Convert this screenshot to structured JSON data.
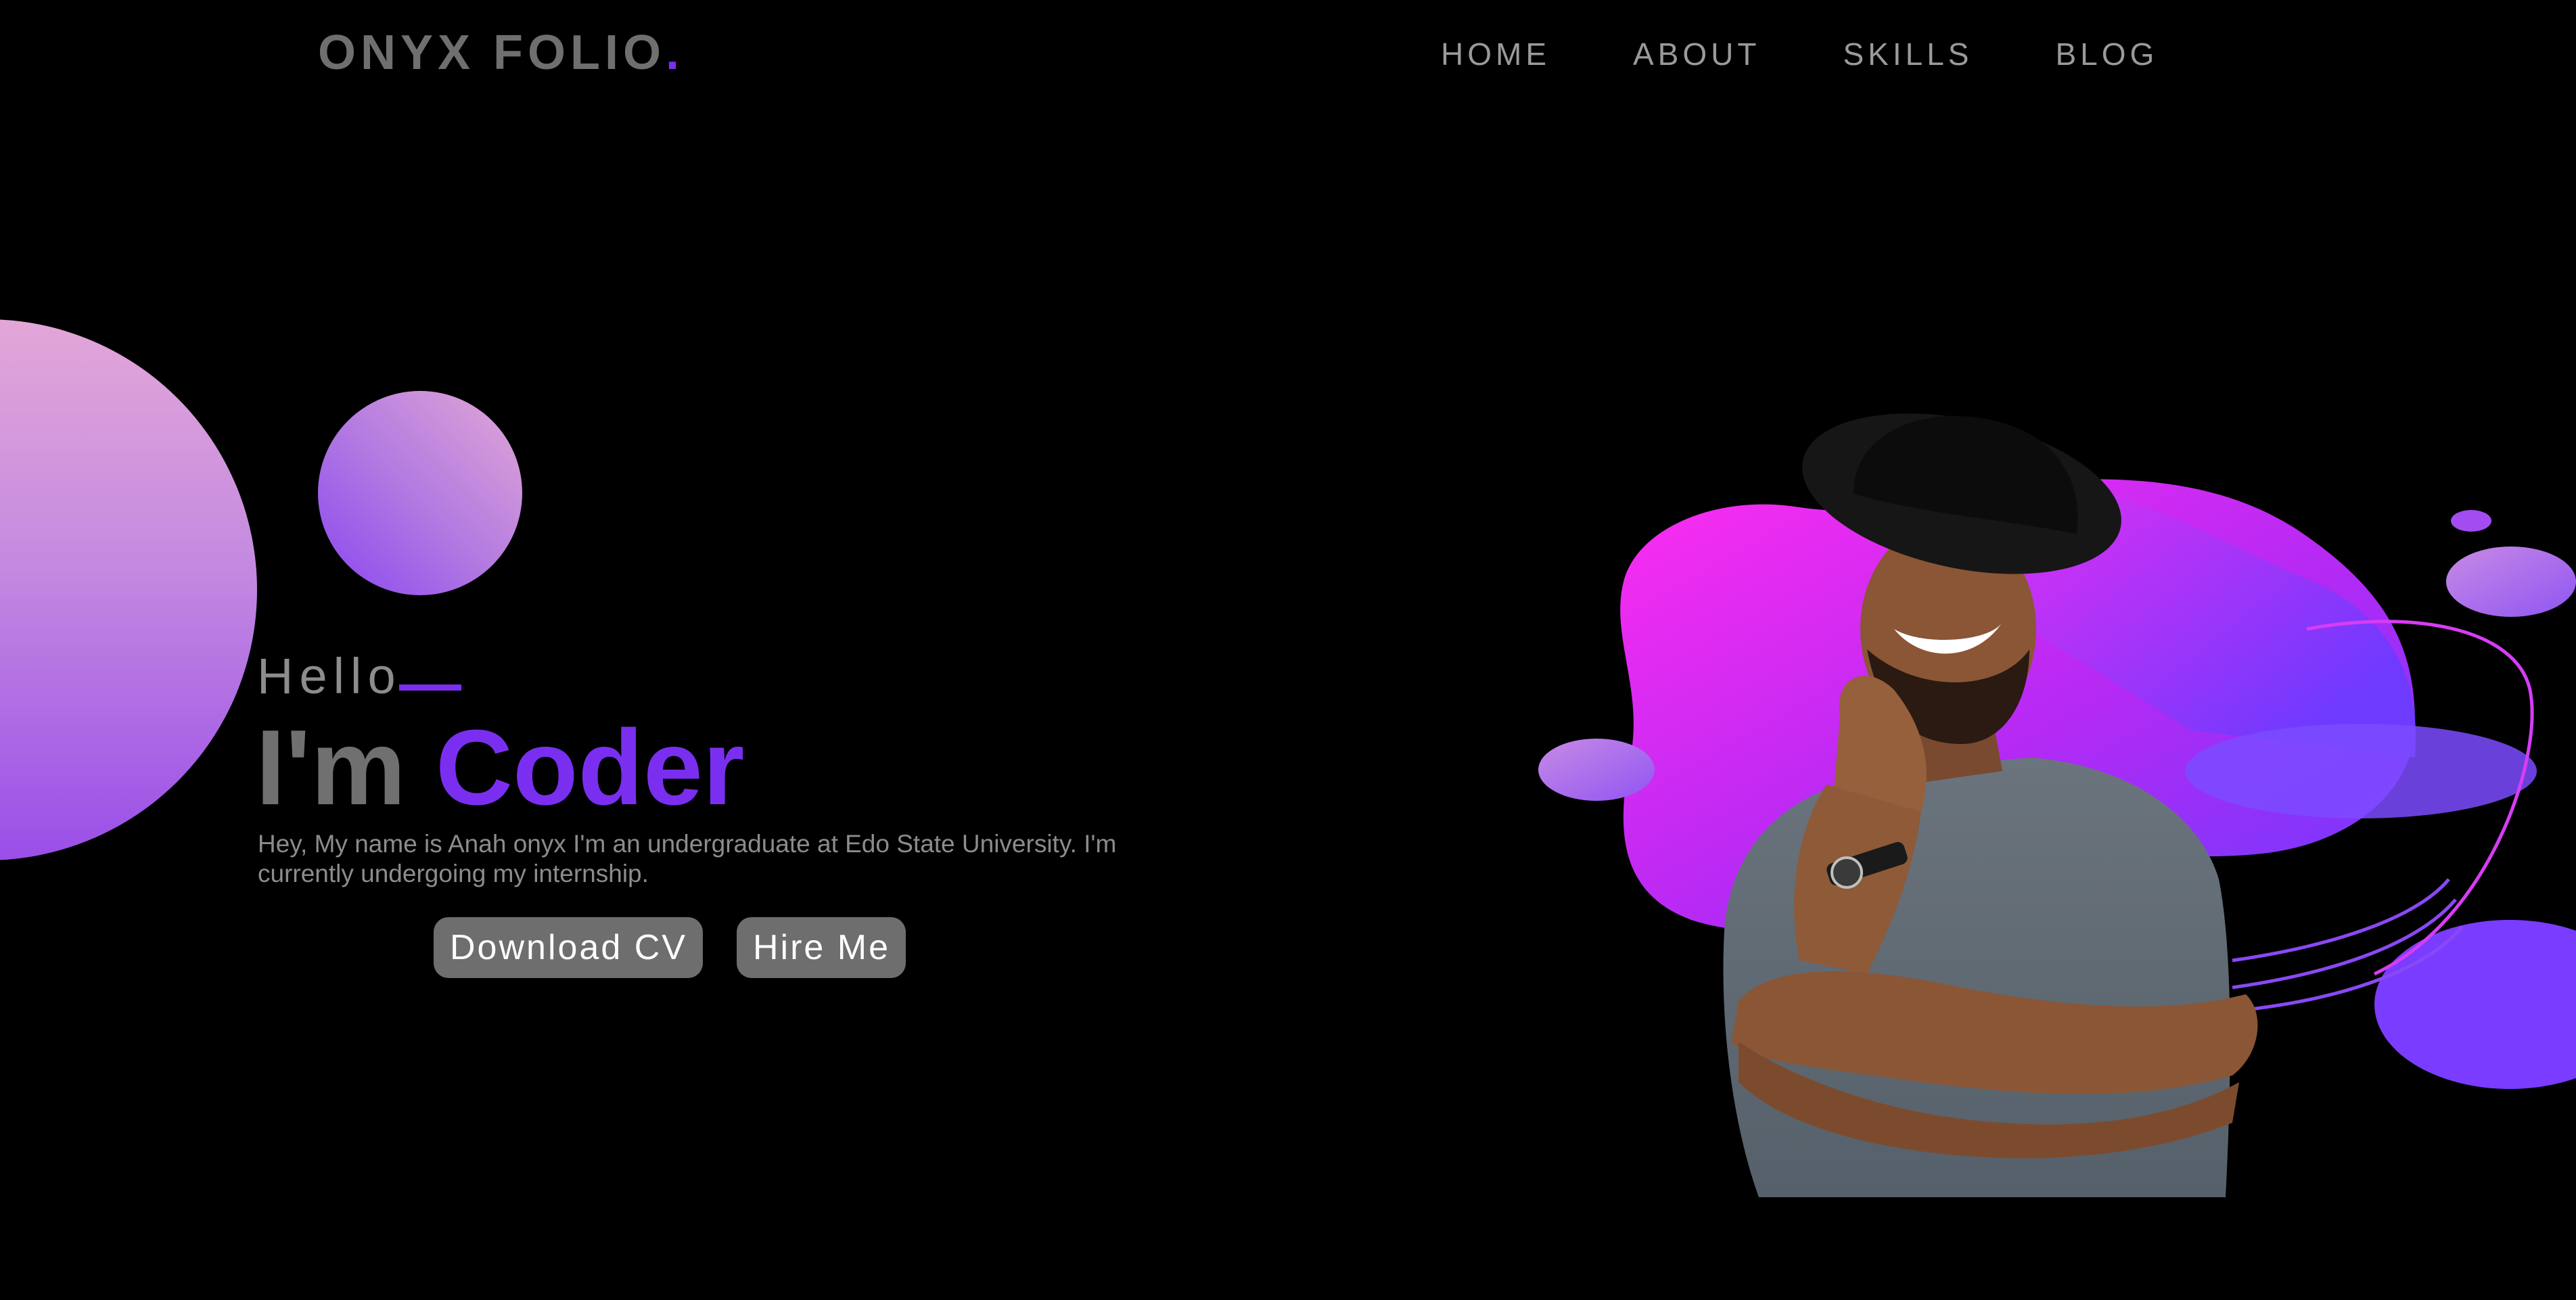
{
  "header": {
    "logo_text": "ONYX FOLIO",
    "logo_dot": "."
  },
  "nav": {
    "items": [
      {
        "label": "HOME"
      },
      {
        "label": "ABOUT"
      },
      {
        "label": "SKILLS"
      },
      {
        "label": "BLOG"
      }
    ]
  },
  "hero": {
    "greeting": "Hello",
    "headline_prefix": "I'm",
    "headline_role": "Coder",
    "intro": "Hey, My name is Anah onyx I'm an undergraduate at Edo State University. I'm currently undergoing my internship.",
    "buttons": {
      "download_cv": "Download CV",
      "hire_me": "Hire Me"
    }
  },
  "colors": {
    "background": "#000000",
    "accent": "#7a2ff0",
    "muted_text": "#8c8c8c",
    "button_bg": "#6e6e6e",
    "blob_magenta": "#ff2cf0",
    "blob_violet": "#7a2ff0"
  }
}
